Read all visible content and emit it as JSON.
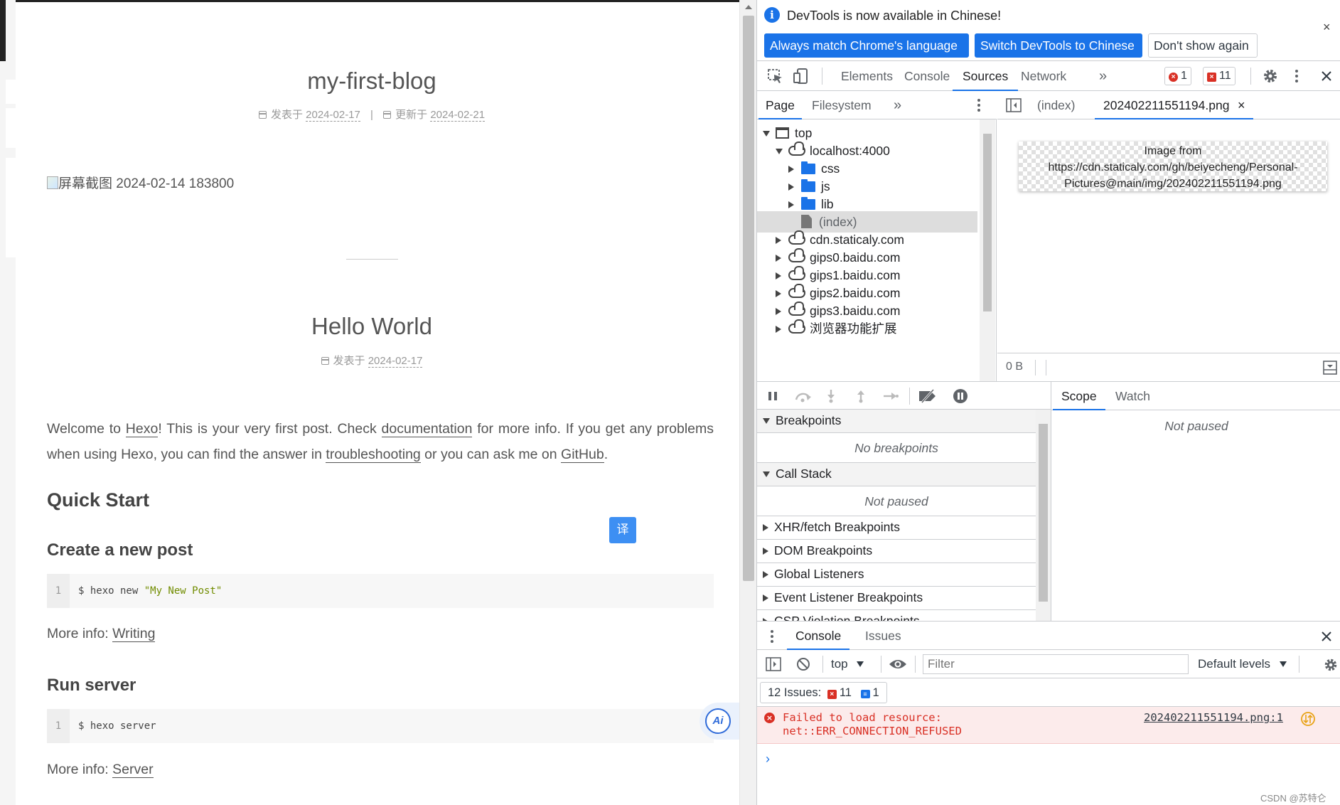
{
  "blog": {
    "post1": {
      "title": "my-first-blog",
      "published_label": "发表于",
      "published_date": "2024-02-17",
      "updated_label": "更新于",
      "updated_date": "2024-02-21",
      "separator": "|",
      "image_alt": "屏幕截图 2024-02-14 183800"
    },
    "post2": {
      "title": "Hello World",
      "published_label": "发表于",
      "published_date": "2024-02-17",
      "para": {
        "t1": "Welcome to ",
        "l1": "Hexo",
        "t2": "! This is your very first post. Check ",
        "l2": "documentation",
        "t3": " for more info. If you get any problems when using Hexo, you can find the answer in ",
        "l3": "troubleshooting",
        "t4": " or you can ask me on ",
        "l4": "GitHub",
        "t5": "."
      },
      "h_quick_start": "Quick Start",
      "h_create_post": "Create a new post",
      "code1": {
        "line": "1",
        "cmd": "$ hexo new ",
        "arg": "\"My New Post\""
      },
      "more1": {
        "label": "More info: ",
        "link": "Writing"
      },
      "h_run_server": "Run server",
      "code2": {
        "line": "1",
        "cmd": "$ hexo server"
      },
      "more2": {
        "label": "More info: ",
        "link": "Server"
      }
    },
    "translate_button": "译",
    "ai_button": "Ai"
  },
  "devtools": {
    "infobar": {
      "icon": "i",
      "message": "DevTools is now available in Chinese!",
      "btn_match": "Always match Chrome's language",
      "btn_switch": "Switch DevTools to Chinese",
      "btn_dismiss": "Don't show again",
      "close": "×"
    },
    "tabs": [
      "Elements",
      "Console",
      "Sources",
      "Network"
    ],
    "more_tabs": "»",
    "error_count": "1",
    "issue_count": "11",
    "navigator": {
      "tabs": [
        "Page",
        "Filesystem"
      ],
      "more": "»",
      "tree": [
        "top",
        "localhost:4000",
        "css",
        "js",
        "lib",
        "(index)",
        "cdn.staticaly.com",
        "gips0.baidu.com",
        "gips1.baidu.com",
        "gips2.baidu.com",
        "gips3.baidu.com",
        "浏览器功能扩展"
      ]
    },
    "editor": {
      "tabs": [
        "(index)",
        "202402211551194.png"
      ],
      "tab_close": "×",
      "preview_line1": "Image from",
      "preview_line2": "https://cdn.staticaly.com/gh/beiyecheng/Personal-",
      "preview_line3": "Pictures@main/img/202402211551194.png",
      "status_size": "0 B"
    },
    "debugger": {
      "sections": {
        "breakpoints": "Breakpoints",
        "no_breakpoints": "No breakpoints",
        "call_stack": "Call Stack",
        "not_paused": "Not paused",
        "xhr": "XHR/fetch Breakpoints",
        "dom": "DOM Breakpoints",
        "global": "Global Listeners",
        "event": "Event Listener Breakpoints",
        "csp": "CSP Violation Breakpoints"
      },
      "scope_tabs": [
        "Scope",
        "Watch"
      ],
      "scope_status": "Not paused"
    },
    "drawer": {
      "tabs": [
        "Console",
        "Issues"
      ],
      "close": "×",
      "context": "top",
      "filter_placeholder": "Filter",
      "levels": "Default levels",
      "issues_label": "12 Issues:",
      "issues_errors": "11",
      "issues_info": "1",
      "error_line1": "Failed to load resource:",
      "error_line2": "net::ERR_CONNECTION_REFUSED",
      "error_source": "202402211551194.png:1",
      "prompt": "›"
    },
    "watermark": "CSDN @苏特仑"
  }
}
